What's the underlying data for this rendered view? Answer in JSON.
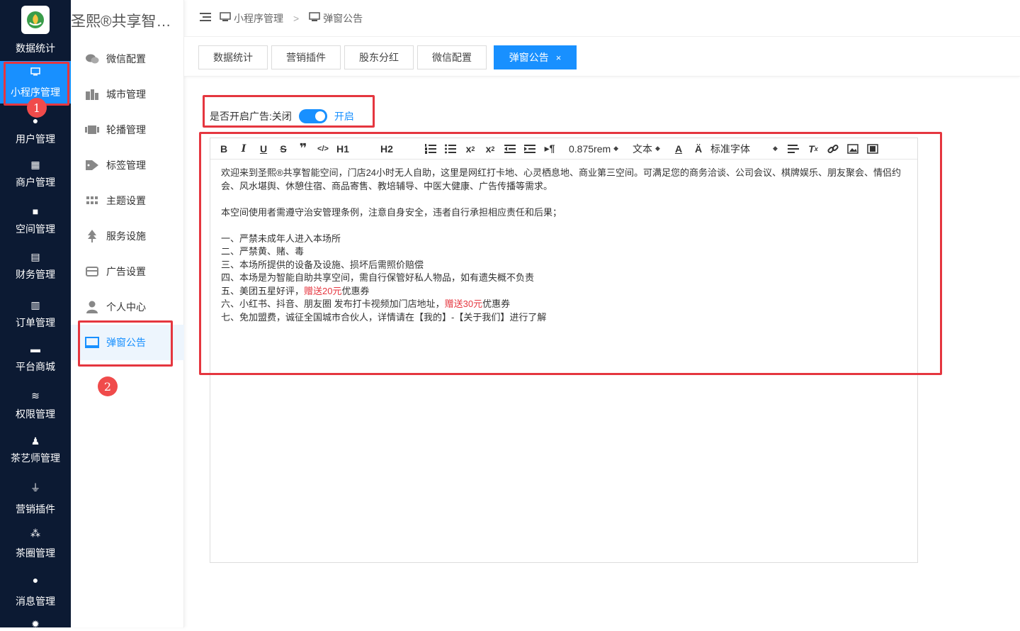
{
  "rail": {
    "items": [
      {
        "label": "数据统计",
        "icon": "chart-icon"
      },
      {
        "label": "小程序管理",
        "icon": "monitor-icon",
        "active": true
      },
      {
        "label": "用户管理",
        "icon": "user-icon"
      },
      {
        "label": "商户管理",
        "icon": "building-icon"
      },
      {
        "label": "空间管理",
        "icon": "box-icon"
      },
      {
        "label": "财务管理",
        "icon": "wallet-icon"
      },
      {
        "label": "订单管理",
        "icon": "clipboard-icon"
      },
      {
        "label": "平台商城",
        "icon": "store-icon"
      },
      {
        "label": "权限管理",
        "icon": "database-icon"
      },
      {
        "label": "茶艺师管理",
        "icon": "user-key-icon"
      },
      {
        "label": "营销插件",
        "icon": "plug-icon"
      },
      {
        "label": "茶圈管理",
        "icon": "group-icon"
      },
      {
        "label": "消息管理",
        "icon": "chat-icon"
      }
    ]
  },
  "sub": {
    "title": "圣熙®共享智能空间",
    "items": [
      {
        "label": "微信配置",
        "icon": "wechat-icon"
      },
      {
        "label": "城市管理",
        "icon": "city-icon"
      },
      {
        "label": "轮播管理",
        "icon": "carousel-icon"
      },
      {
        "label": "标签管理",
        "icon": "tag-icon"
      },
      {
        "label": "主题设置",
        "icon": "grid-icon"
      },
      {
        "label": "服务设施",
        "icon": "tree-icon"
      },
      {
        "label": "广告设置",
        "icon": "card-icon"
      },
      {
        "label": "个人中心",
        "icon": "person-icon"
      },
      {
        "label": "弹窗公告",
        "icon": "screen-icon",
        "active": true
      }
    ]
  },
  "header": {
    "breadcrumb": [
      "小程序管理",
      "弹窗公告"
    ],
    "sep": ">"
  },
  "tabs": [
    {
      "label": "数据统计"
    },
    {
      "label": "营销插件"
    },
    {
      "label": "股东分红"
    },
    {
      "label": "微信配置"
    },
    {
      "label": "弹窗公告",
      "active": true,
      "close": "×"
    }
  ],
  "annotations": {
    "badge1": "1",
    "badge2": "2"
  },
  "ad_toggle": {
    "label": "是否开启广告:关闭",
    "on_label": "开启",
    "enabled": true
  },
  "editor": {
    "toolbar": {
      "h1": "H1",
      "h2": "H2",
      "font_size": "0.875rem",
      "block_type": "文本",
      "font_family": "标准字体"
    },
    "paragraphs": {
      "p1": "欢迎来到圣熙®共享智能空间，门店24小时无人自助，这里是网红打卡地、心灵栖息地、商业第三空间。可满足您的商务洽谈、公司会议、棋牌娱乐、朋友聚会、情侣约会、风水堪舆、休憩住宿、商品寄售、教培辅导、中医大健康、广告传播等需求。",
      "p2": "本空间使用者需遵守治安管理条例，注意自身安全，违者自行承担相应责任和后果；",
      "l1": "一、严禁未成年人进入本场所",
      "l2": "二、严禁黄、赌、毒",
      "l3": "三、本场所提供的设备及设施、损坏后需照价赔偿",
      "l4": "四、本场是为智能自助共享空间，需自行保管好私人物品，如有遗失概不负责",
      "l5a": "五、美团五星好评，",
      "l5b": "赠送20元",
      "l5c": "优惠券",
      "l6a": "六、小红书、抖音、朋友圈 发布打卡视频加门店地址，",
      "l6b": "赠送30元",
      "l6c": "优惠券",
      "l7": "七、免加盟费，诚征全国城市合伙人，详情请在【我的】-【关于我们】进行了解"
    }
  }
}
